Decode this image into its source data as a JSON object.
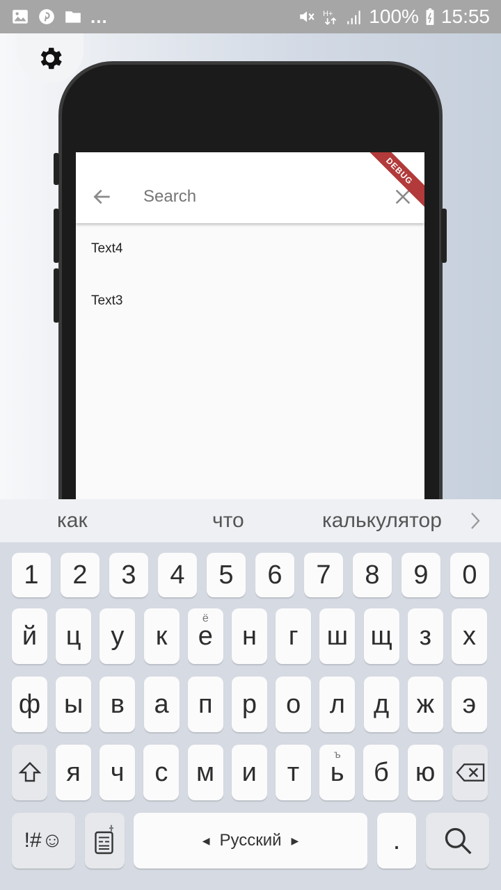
{
  "statusbar": {
    "battery": "100%",
    "time": "15:55",
    "dots": "...",
    "icons": [
      "gallery-icon",
      "pinterest-icon",
      "folder-icon",
      "mute-icon",
      "data-icon",
      "signal-icon",
      "battery-icon"
    ]
  },
  "app": {
    "search_placeholder": "Search",
    "debug_banner": "DEBUG",
    "items": [
      "Text4",
      "Text3"
    ]
  },
  "keyboard": {
    "suggestions": [
      "как",
      "что",
      "калькулятор"
    ],
    "row_numbers": [
      "1",
      "2",
      "3",
      "4",
      "5",
      "6",
      "7",
      "8",
      "9",
      "0"
    ],
    "row1": [
      "й",
      "ц",
      "у",
      "к",
      "е",
      "н",
      "г",
      "ш",
      "щ",
      "з",
      "х"
    ],
    "row1_sup": {
      "4": "ё"
    },
    "row2": [
      "ф",
      "ы",
      "в",
      "а",
      "п",
      "р",
      "о",
      "л",
      "д",
      "ж",
      "э"
    ],
    "row3": [
      "я",
      "ч",
      "с",
      "м",
      "и",
      "т",
      "ь",
      "б",
      "ю"
    ],
    "row3_sup": {
      "6": "ъ"
    },
    "symbols_label": "!#☺",
    "space_label": "Русский",
    "period_label": "."
  },
  "colors": {
    "debug": "#b23a3a",
    "statusbar": "#a6a6a6",
    "keyboard_bg": "#d6dae2"
  }
}
